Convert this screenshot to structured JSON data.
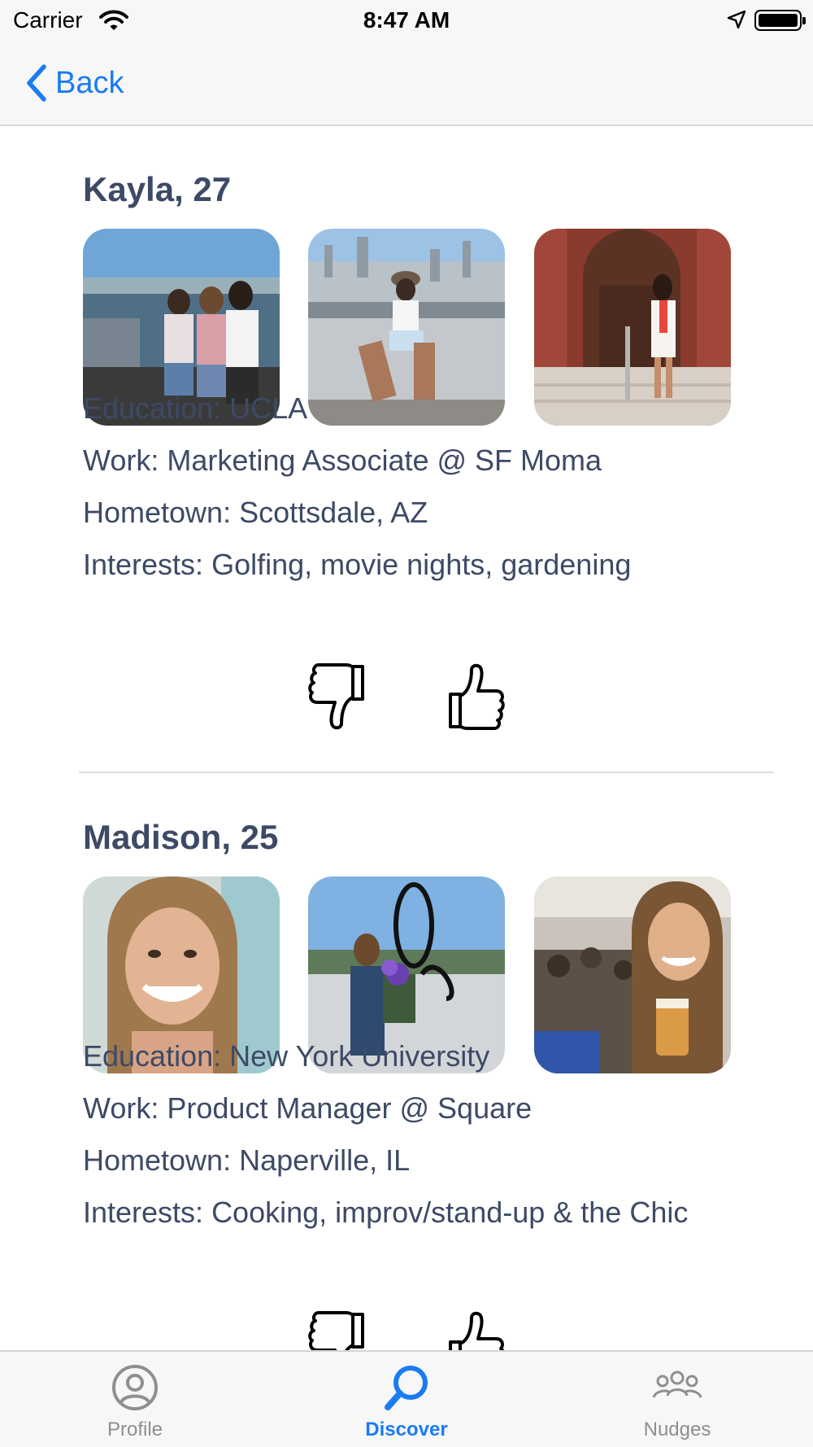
{
  "status": {
    "carrier": "Carrier",
    "time": "8:47 AM"
  },
  "nav": {
    "back_label": "Back"
  },
  "profiles": [
    {
      "name": "Kayla, 27",
      "photos": [
        "group-friends-waterfront-photo",
        "rooftop-city-skyline-photo",
        "graduation-archway-photo"
      ],
      "education": "Education: UCLA",
      "work": "Work: Marketing Associate @ SF Moma",
      "hometown": "Hometown: Scottsdale, AZ",
      "interests": "Interests: Golfing, movie nights, gardening"
    },
    {
      "name": "Madison, 25",
      "photos": [
        "selfie-photo",
        "sculpture-bouquet-photo",
        "restaurant-beer-photo"
      ],
      "education": "Education: New York University",
      "work": "Work: Product Manager @ Square",
      "hometown": "Hometown: Naperville, IL",
      "interests": "Interests: Cooking, improv/stand-up & the Chic"
    }
  ],
  "tabs": [
    {
      "label": "Profile",
      "icon": "person-circle-icon",
      "active": false
    },
    {
      "label": "Discover",
      "icon": "search-icon",
      "active": true
    },
    {
      "label": "Nudges",
      "icon": "group-people-icon",
      "active": false
    }
  ],
  "colors": {
    "accent": "#1a7cf0",
    "text": "#3d4a66",
    "inactive_tab": "#8e8e93"
  }
}
